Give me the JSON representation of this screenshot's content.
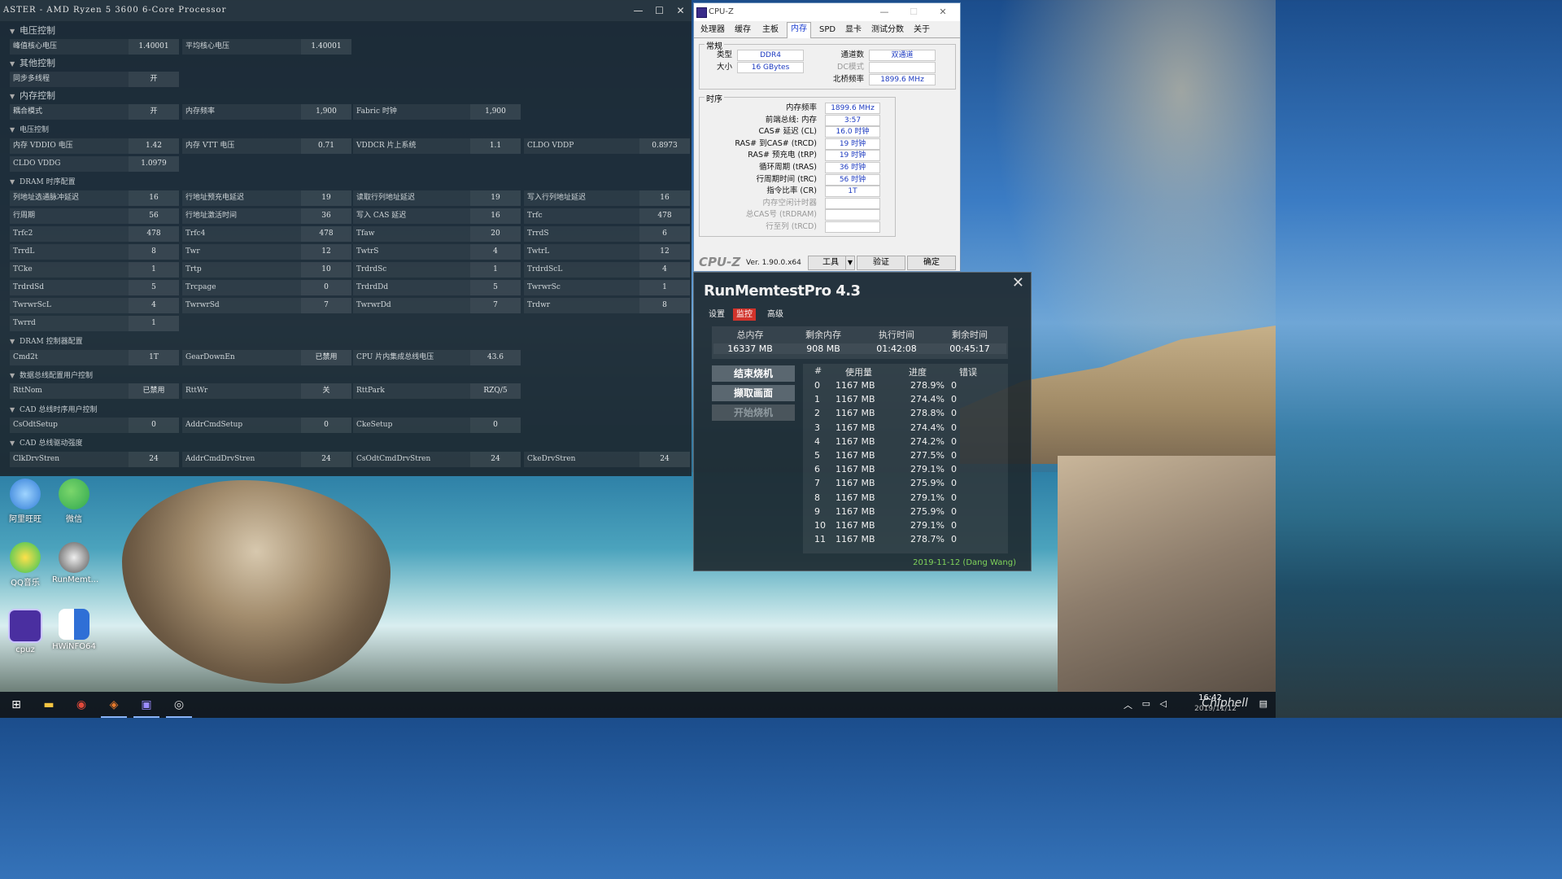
{
  "ryzen_master": {
    "title": "ASTER  - AMD Ryzen 5 3600 6-Core Processor",
    "sections": {
      "voltage": "电压控制",
      "other": "其他控制",
      "memory": "内存控制",
      "power": "电压控制",
      "dram_timing": "DRAM 时序配置",
      "dram_controller": "DRAM 控制器配置",
      "data_bus": "数据总线配置用户控制",
      "cad_bus_timing": "CAD 总线时序用户控制",
      "cad_bus_drive": "CAD 总线驱动强度"
    },
    "rows": {
      "peak_core_v": {
        "label": "峰值核心电压",
        "value": "1.40001"
      },
      "avg_core_v": {
        "label": "平均核心电压",
        "value": "1.40001"
      },
      "smt": {
        "label": "同步多线程",
        "value": "开"
      },
      "coupled": {
        "label": "耦合模式",
        "value": "开"
      },
      "mem_freq": {
        "label": "内存频率",
        "value": "1,900"
      },
      "fabric": {
        "label": "Fabric 时钟",
        "value": "1,900"
      },
      "vddio": {
        "label": "内存 VDDIO 电压",
        "value": "1.42"
      },
      "vtt": {
        "label": "内存 VTT 电压",
        "value": "0.71"
      },
      "vddcr": {
        "label": "VDDCR 片上系统",
        "value": "1.1"
      },
      "cldo_vddp": {
        "label": "CLDO VDDP",
        "value": "0.8973"
      },
      "cldo_vddg": {
        "label": "CLDO VDDG",
        "value": "1.0979"
      }
    },
    "timing": [
      [
        {
          "label": "列地址选通脉冲延迟",
          "value": "16"
        },
        {
          "label": "行地址预充电延迟",
          "value": "19"
        },
        {
          "label": "读取行列地址延迟",
          "value": "19"
        },
        {
          "label": "写入行列地址延迟",
          "value": "16"
        }
      ],
      [
        {
          "label": "行周期",
          "value": "56"
        },
        {
          "label": "行地址激活时间",
          "value": "36"
        },
        {
          "label": "写入 CAS 延迟",
          "value": "16"
        },
        {
          "label": "Trfc",
          "value": "478"
        }
      ],
      [
        {
          "label": "Trfc2",
          "value": "478"
        },
        {
          "label": "Trfc4",
          "value": "478"
        },
        {
          "label": "Tfaw",
          "value": "20"
        },
        {
          "label": "TrrdS",
          "value": "6"
        }
      ],
      [
        {
          "label": "TrrdL",
          "value": "8"
        },
        {
          "label": "Twr",
          "value": "12"
        },
        {
          "label": "TwtrS",
          "value": "4"
        },
        {
          "label": "TwtrL",
          "value": "12"
        }
      ],
      [
        {
          "label": "TCke",
          "value": "1"
        },
        {
          "label": "Trtp",
          "value": "10"
        },
        {
          "label": "TrdrdSc",
          "value": "1"
        },
        {
          "label": "TrdrdScL",
          "value": "4"
        }
      ],
      [
        {
          "label": "TrdrdSd",
          "value": "5"
        },
        {
          "label": "Trcpage",
          "value": "0"
        },
        {
          "label": "TrdrdDd",
          "value": "5"
        },
        {
          "label": "TwrwrSc",
          "value": "1"
        }
      ],
      [
        {
          "label": "TwrwrScL",
          "value": "4"
        },
        {
          "label": "TwrwrSd",
          "value": "7"
        },
        {
          "label": "TwrwrDd",
          "value": "7"
        },
        {
          "label": "Trdwr",
          "value": "8"
        }
      ],
      [
        {
          "label": "Twrrd",
          "value": "1"
        }
      ]
    ],
    "controller": [
      {
        "label": "Cmd2t",
        "value": "1T"
      },
      {
        "label": "GearDownEn",
        "value": "已禁用"
      },
      {
        "label": "CPU 片内集成总线电压",
        "value": "43.6"
      }
    ],
    "databus": [
      {
        "label": "RttNom",
        "value": "已禁用"
      },
      {
        "label": "RttWr",
        "value": "关"
      },
      {
        "label": "RttPark",
        "value": "RZQ/5"
      }
    ],
    "cadtiming": [
      {
        "label": "CsOdtSetup",
        "value": "0"
      },
      {
        "label": "AddrCmdSetup",
        "value": "0"
      },
      {
        "label": "CkeSetup",
        "value": "0"
      }
    ],
    "caddrive": [
      {
        "label": "ClkDrvStren",
        "value": "24"
      },
      {
        "label": "AddrCmdDrvStren",
        "value": "24"
      },
      {
        "label": "CsOdtCmdDrvStren",
        "value": "24"
      },
      {
        "label": "CkeDrvStren",
        "value": "24"
      }
    ]
  },
  "cpuz": {
    "title": "CPU-Z",
    "tabs": [
      "处理器",
      "缓存",
      "主板",
      "内存",
      "SPD",
      "显卡",
      "测试分数",
      "关于"
    ],
    "general_title": "常规",
    "type_label": "类型",
    "type_value": "DDR4",
    "size_label": "大小",
    "size_value": "16 GBytes",
    "channels_label": "通道数",
    "channels_value": "双通道",
    "dc_label": "DC模式",
    "dc_value": "",
    "nb_label": "北桥频率",
    "nb_value": "1899.6 MHz",
    "timing_title": "时序",
    "timings": [
      {
        "label": "内存频率",
        "value": "1899.6 MHz",
        "dim": false
      },
      {
        "label": "前端总线: 内存",
        "value": "3:57",
        "dim": false
      },
      {
        "label": "CAS# 延迟 (CL)",
        "value": "16.0 时钟",
        "dim": false
      },
      {
        "label": "RAS# 到CAS# (tRCD)",
        "value": "19 时钟",
        "dim": false
      },
      {
        "label": "RAS# 预充电 (tRP)",
        "value": "19 时钟",
        "dim": false
      },
      {
        "label": "循环周期 (tRAS)",
        "value": "36 时钟",
        "dim": false
      },
      {
        "label": "行周期时间 (tRC)",
        "value": "56 时钟",
        "dim": false
      },
      {
        "label": "指令比率 (CR)",
        "value": "1T",
        "dim": false
      },
      {
        "label": "内存空闲计时器",
        "value": "",
        "dim": true
      },
      {
        "label": "总CAS号 (tRDRAM)",
        "value": "",
        "dim": true
      },
      {
        "label": "行至列 (tRCD)",
        "value": "",
        "dim": true
      }
    ],
    "brand": "CPU-Z",
    "version": "Ver. 1.90.0.x64",
    "tools_label": "工具",
    "validate_label": "验证",
    "ok_label": "确定"
  },
  "memtest": {
    "title": "RunMemtestPro 4.3",
    "tabs": [
      "设置",
      "监控",
      "高级"
    ],
    "summary_headers": [
      "总内存",
      "剩余内存",
      "执行时间",
      "剩余时间"
    ],
    "summary_values": [
      "16337 MB",
      "908 MB",
      "01:42:08",
      "00:45:17"
    ],
    "btn_stop": "结束烧机",
    "btn_capture": "撷取画面",
    "btn_start": "开始烧机",
    "table_headers": [
      "#",
      "使用量",
      "进度",
      "错误"
    ],
    "rows": [
      [
        "0",
        "1167 MB",
        "278.9%",
        "0"
      ],
      [
        "1",
        "1167 MB",
        "274.4%",
        "0"
      ],
      [
        "2",
        "1167 MB",
        "278.8%",
        "0"
      ],
      [
        "3",
        "1167 MB",
        "274.4%",
        "0"
      ],
      [
        "4",
        "1167 MB",
        "274.2%",
        "0"
      ],
      [
        "5",
        "1167 MB",
        "277.5%",
        "0"
      ],
      [
        "6",
        "1167 MB",
        "279.1%",
        "0"
      ],
      [
        "7",
        "1167 MB",
        "275.9%",
        "0"
      ],
      [
        "8",
        "1167 MB",
        "279.1%",
        "0"
      ],
      [
        "9",
        "1167 MB",
        "275.9%",
        "0"
      ],
      [
        "10",
        "1167 MB",
        "279.1%",
        "0"
      ],
      [
        "11",
        "1167 MB",
        "278.7%",
        "0"
      ]
    ],
    "footer": "2019-11-12 (Dang Wang)"
  },
  "desktop": {
    "icons": [
      "阿里旺旺",
      "微信",
      "QQ音乐",
      "RunMemt...",
      "cpuz",
      "HWiNFO64"
    ]
  },
  "taskbar": {
    "time": "16:42",
    "date": "2019/11/12",
    "watermark": "Chiphell"
  }
}
